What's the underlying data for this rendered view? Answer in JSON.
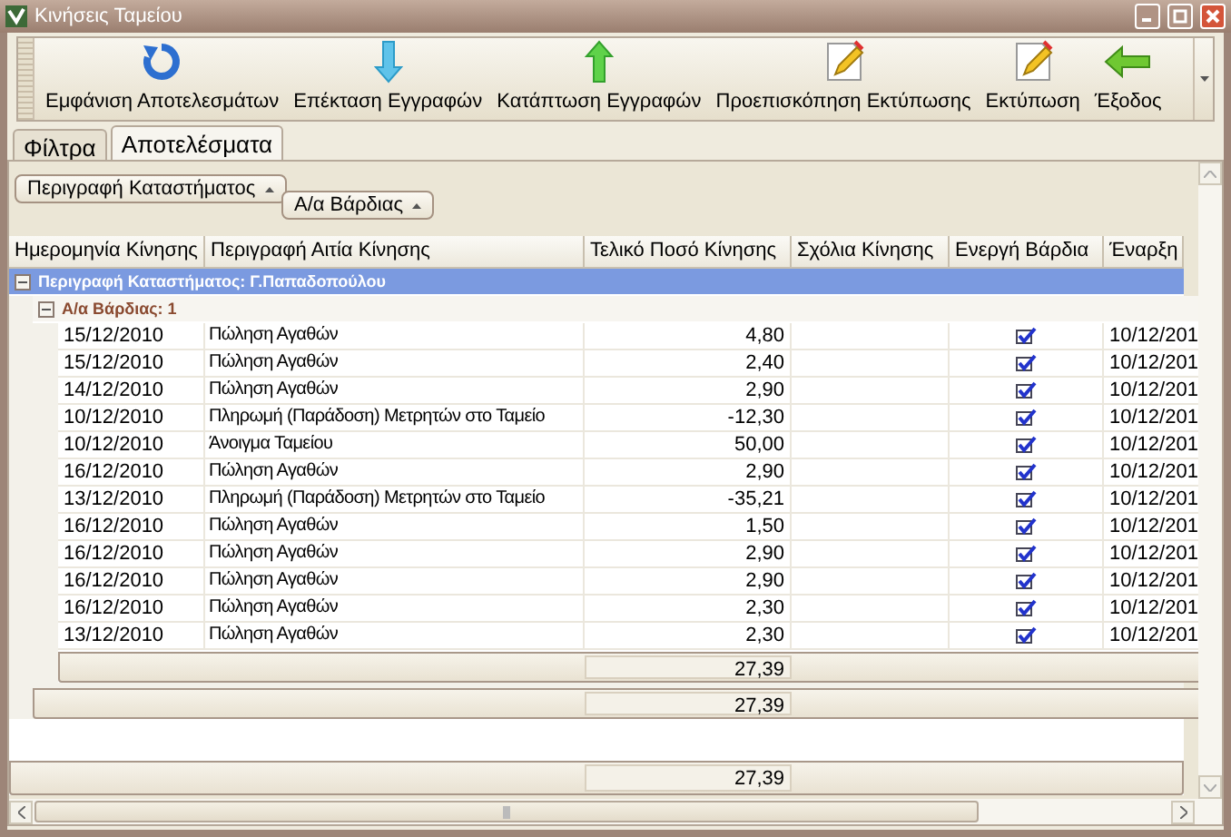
{
  "window": {
    "title": "Κινήσεις Ταμείου"
  },
  "toolbar": [
    {
      "label": "Εμφάνιση Αποτελεσμάτων",
      "kind": "refresh"
    },
    {
      "label": "Επέκταση Εγγραφών",
      "kind": "down"
    },
    {
      "label": "Κατάπτωση Εγγραφών",
      "kind": "up"
    },
    {
      "label": "Προεπισκόπηση Εκτύπωσης",
      "kind": "edit"
    },
    {
      "label": "Εκτύπωση",
      "kind": "edit"
    },
    {
      "label": "Έξοδος",
      "kind": "back"
    }
  ],
  "tabs": [
    {
      "label": "Φίλτρα",
      "selected": false
    },
    {
      "label": "Αποτελέσματα",
      "selected": true
    }
  ],
  "group_by": [
    {
      "label": "Περιγραφή Καταστήματος"
    },
    {
      "label": "Α/α Βάρδιας"
    }
  ],
  "table": {
    "columns": [
      "Ημερομηνία Κίνησης",
      "Περιγραφή Αιτία Κίνησης",
      "Τελικό Ποσό Κίνησης",
      "Σχόλια Κίνησης",
      "Ενεργή Βάρδια",
      "Έναρξη"
    ],
    "group": {
      "label": "Περιγραφή Καταστήματος: Γ.Παπαδοπούλου",
      "expanded": true,
      "total": "27,39",
      "subgroup": {
        "label": "Α/α Βάρδιας: 1",
        "expanded": true,
        "total": "27,39",
        "rows": [
          {
            "date": "15/12/2010",
            "description": "Πώληση Αγαθών",
            "amount": "4,80",
            "active": true,
            "start": "10/12/201"
          },
          {
            "date": "15/12/2010",
            "description": "Πώληση Αγαθών",
            "amount": "2,40",
            "active": true,
            "start": "10/12/201"
          },
          {
            "date": "14/12/2010",
            "description": "Πώληση Αγαθών",
            "amount": "2,90",
            "active": true,
            "start": "10/12/201"
          },
          {
            "date": "10/12/2010",
            "description": "Πληρωμή (Παράδοση) Μετρητών στο Ταμείο",
            "amount": "-12,30",
            "active": true,
            "start": "10/12/201"
          },
          {
            "date": "10/12/2010",
            "description": "Άνοιγμα Ταμείου",
            "amount": "50,00",
            "active": true,
            "start": "10/12/201"
          },
          {
            "date": "16/12/2010",
            "description": "Πώληση Αγαθών",
            "amount": "2,90",
            "active": true,
            "start": "10/12/201"
          },
          {
            "date": "13/12/2010",
            "description": "Πληρωμή (Παράδοση) Μετρητών στο Ταμείο",
            "amount": "-35,21",
            "active": true,
            "start": "10/12/201"
          },
          {
            "date": "16/12/2010",
            "description": "Πώληση Αγαθών",
            "amount": "1,50",
            "active": true,
            "start": "10/12/201"
          },
          {
            "date": "16/12/2010",
            "description": "Πώληση Αγαθών",
            "amount": "2,90",
            "active": true,
            "start": "10/12/201"
          },
          {
            "date": "16/12/2010",
            "description": "Πώληση Αγαθών",
            "amount": "2,90",
            "active": true,
            "start": "10/12/201"
          },
          {
            "date": "16/12/2010",
            "description": "Πώληση Αγαθών",
            "amount": "2,30",
            "active": true,
            "start": "10/12/201"
          },
          {
            "date": "13/12/2010",
            "description": "Πώληση Αγαθών",
            "amount": "2,30",
            "active": true,
            "start": "10/12/201"
          }
        ]
      }
    },
    "grand_total": "27,39"
  }
}
